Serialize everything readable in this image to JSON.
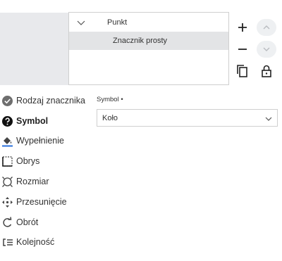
{
  "tree": {
    "parent_label": "Punkt",
    "child_label": "Znacznik prosty"
  },
  "nav": {
    "items": [
      {
        "label": "Rodzaj znacznika",
        "icon": "check-circle-icon"
      },
      {
        "label": "Symbol",
        "icon": "question-circle-icon"
      },
      {
        "label": "Wypełnienie",
        "icon": "paint-bucket-icon"
      },
      {
        "label": "Obrys",
        "icon": "dashed-square-icon"
      },
      {
        "label": "Rozmiar",
        "icon": "resize-icon"
      },
      {
        "label": "Przesunięcie",
        "icon": "move-arrows-icon"
      },
      {
        "label": "Obrót",
        "icon": "rotate-icon"
      },
      {
        "label": "Kolejność",
        "icon": "order-icon"
      }
    ],
    "active": "Symbol"
  },
  "symbol_field": {
    "label": "Symbol •",
    "value": "Koło"
  }
}
